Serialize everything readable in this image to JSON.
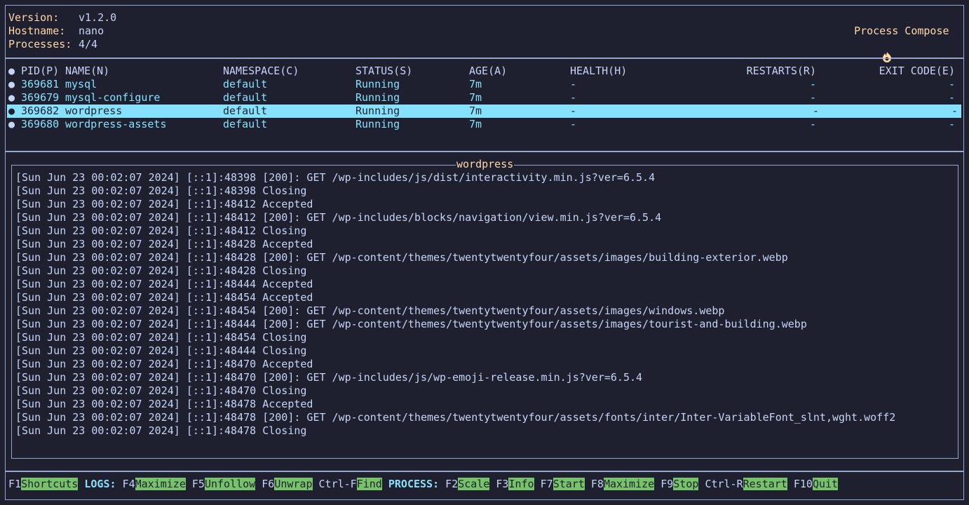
{
  "header": {
    "version_label": "Version:",
    "version_value": "v1.2.0",
    "hostname_label": "Hostname:",
    "hostname_value": "nano",
    "processes_label": "Processes:",
    "processes_value": "4/4",
    "app_title": "Process Compose",
    "app_icon": "flame-icon"
  },
  "table": {
    "columns": [
      "PID(P)",
      "NAME(N)",
      "NAMESPACE(C)",
      "STATUS(S)",
      "AGE(A)",
      "HEALTH(H)",
      "RESTARTS(R)",
      "EXIT CODE(E)"
    ],
    "rows": [
      {
        "pid": "369681",
        "name": "mysql",
        "namespace": "default",
        "status": "Running",
        "age": "7m",
        "health": "-",
        "restarts": "-",
        "exit": "-"
      },
      {
        "pid": "369679",
        "name": "mysql-configure",
        "namespace": "default",
        "status": "Running",
        "age": "7m",
        "health": "-",
        "restarts": "-",
        "exit": "-"
      },
      {
        "pid": "369682",
        "name": "wordpress",
        "namespace": "default",
        "status": "Running",
        "age": "7m",
        "health": "-",
        "restarts": "-",
        "exit": "-"
      },
      {
        "pid": "369680",
        "name": "wordpress-assets",
        "namespace": "default",
        "status": "Running",
        "age": "7m",
        "health": "-",
        "restarts": "-",
        "exit": "-"
      }
    ],
    "bullet": "●"
  },
  "logs": {
    "title": "wordpress",
    "lines": [
      "[Sun Jun 23 00:02:07 2024] [::1]:48398 [200]: GET /wp-includes/js/dist/interactivity.min.js?ver=6.5.4",
      "[Sun Jun 23 00:02:07 2024] [::1]:48398 Closing",
      "[Sun Jun 23 00:02:07 2024] [::1]:48412 Accepted",
      "[Sun Jun 23 00:02:07 2024] [::1]:48412 [200]: GET /wp-includes/blocks/navigation/view.min.js?ver=6.5.4",
      "[Sun Jun 23 00:02:07 2024] [::1]:48412 Closing",
      "[Sun Jun 23 00:02:07 2024] [::1]:48428 Accepted",
      "[Sun Jun 23 00:02:07 2024] [::1]:48428 [200]: GET /wp-content/themes/twentytwentyfour/assets/images/building-exterior.webp",
      "[Sun Jun 23 00:02:07 2024] [::1]:48428 Closing",
      "[Sun Jun 23 00:02:07 2024] [::1]:48444 Accepted",
      "[Sun Jun 23 00:02:07 2024] [::1]:48454 Accepted",
      "[Sun Jun 23 00:02:07 2024] [::1]:48454 [200]: GET /wp-content/themes/twentytwentyfour/assets/images/windows.webp",
      "[Sun Jun 23 00:02:07 2024] [::1]:48444 [200]: GET /wp-content/themes/twentytwentyfour/assets/images/tourist-and-building.webp",
      "[Sun Jun 23 00:02:07 2024] [::1]:48454 Closing",
      "[Sun Jun 23 00:02:07 2024] [::1]:48444 Closing",
      "[Sun Jun 23 00:02:07 2024] [::1]:48470 Accepted",
      "[Sun Jun 23 00:02:07 2024] [::1]:48470 [200]: GET /wp-includes/js/wp-emoji-release.min.js?ver=6.5.4",
      "[Sun Jun 23 00:02:07 2024] [::1]:48470 Closing",
      "[Sun Jun 23 00:02:07 2024] [::1]:48478 Accepted",
      "[Sun Jun 23 00:02:07 2024] [::1]:48478 [200]: GET /wp-content/themes/twentytwentyfour/assets/fonts/inter/Inter-VariableFont_slnt,wght.woff2",
      "[Sun Jun 23 00:02:07 2024] [::1]:48478 Closing"
    ]
  },
  "footer": {
    "f1_key": "F1",
    "f1_label": "Shortcuts",
    "logs_section": "LOGS:",
    "f4_key": "F4",
    "f4_label": "Maximize",
    "f5_key": "F5",
    "f5_label": "Unfollow",
    "f6_key": "F6",
    "f6_label": "Unwrap",
    "ctrlf_key": "Ctrl-F",
    "ctrlf_label": "Find",
    "process_section": "PROCESS:",
    "f2_key": "F2",
    "f2_label": "Scale",
    "f3_key": "F3",
    "f3_label": "Info",
    "f7_key": "F7",
    "f7_label": "Start",
    "f8_key": "F8",
    "f8_label": "Maximize",
    "f9_key": "F9",
    "f9_label": "Stop",
    "ctrlr_key": "Ctrl-R",
    "ctrlr_label": "Restart",
    "f10_key": "F10",
    "f10_label": "Quit"
  },
  "colors": {
    "background": "#1e2030",
    "border": "#9aa5ce",
    "label": "#ffd8a8",
    "accent": "#86e1fc",
    "selected_row": "#86e1fc",
    "key_badge": "#77c36a"
  }
}
